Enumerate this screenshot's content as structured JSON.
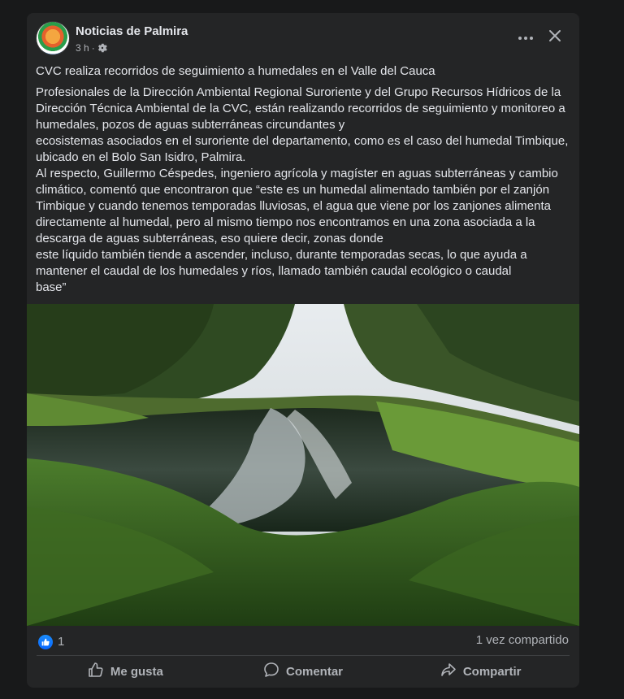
{
  "post": {
    "author": "Noticias de Palmira",
    "time": "3 h",
    "title": "CVC realiza recorridos de seguimiento a humedales en el Valle del Cauca",
    "body_lines": [
      "Profesionales de la Dirección Ambiental Regional Suroriente y del Grupo Recursos Hídricos de la",
      "Dirección Técnica Ambiental de la CVC, están realizando recorridos de seguimiento y monitoreo a",
      "humedales, pozos de aguas subterráneas circundantes y",
      "ecosistemas asociados en el suroriente del departamento, como es el caso del humedal Timbique,",
      "ubicado en el Bolo San Isidro, Palmira.",
      "Al respecto, Guillermo Céspedes, ingeniero agrícola y magíster en aguas subterráneas y cambio",
      "climático, comentó que encontraron que “este es un humedal alimentado también por el zanjón",
      "Timbique y cuando tenemos temporadas lluviosas, el agua que viene por los zanjones alimenta",
      "directamente al humedal, pero al mismo tiempo nos encontramos en una zona asociada a la",
      "descarga de aguas subterráneas, eso quiere decir, zonas donde",
      "este líquido también tiende a ascender, incluso, durante temporadas secas, lo que ayuda a",
      "mantener el caudal de los humedales y ríos, llamado también caudal ecológico o caudal",
      "base”"
    ]
  },
  "stats": {
    "reactions": "1",
    "shares": "1 vez compartido"
  },
  "actions": {
    "like": "Me gusta",
    "comment": "Comentar",
    "share": "Compartir"
  },
  "icons": {
    "privacy": "gear-icon",
    "more": "more-horizontal-icon",
    "close": "close-icon",
    "like": "thumbs-up-icon",
    "comment": "comment-bubble-icon",
    "share": "share-arrow-icon"
  },
  "colors": {
    "background": "#18191a",
    "card": "#242526",
    "text_primary": "#e4e6eb",
    "text_secondary": "#b0b3b8",
    "like_blue": "#0866ff"
  }
}
